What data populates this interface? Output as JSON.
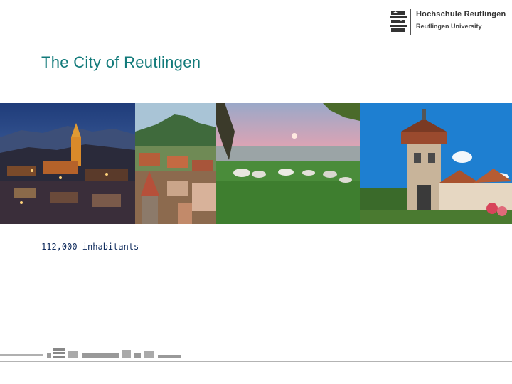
{
  "logo": {
    "name": "Hochschule Reutlingen",
    "subtitle": "Reutlingen University"
  },
  "slide": {
    "title": "The City of Reutlingen",
    "caption": "112,000 inhabitants"
  },
  "photos": [
    {
      "id": "night-cityscape-cathedral"
    },
    {
      "id": "old-town-rooftops-hill"
    },
    {
      "id": "sheep-meadow-sunset-view"
    },
    {
      "id": "tower-gate-tübinger-tor"
    }
  ]
}
